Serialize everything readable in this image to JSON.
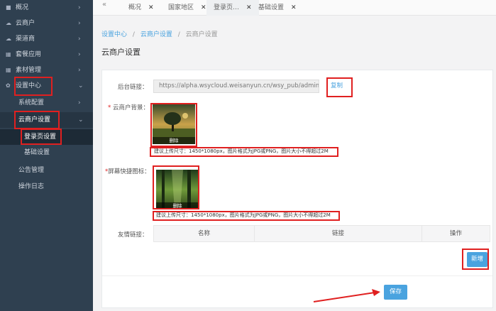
{
  "sidebar": {
    "items": [
      {
        "icon": "user-icon",
        "label": "概况"
      },
      {
        "icon": "cloud-icon",
        "label": "云商户"
      },
      {
        "icon": "channel-icon",
        "label": "渠道商"
      },
      {
        "icon": "grid-icon",
        "label": "套餐应用"
      },
      {
        "icon": "grid-icon",
        "label": "素材管理"
      },
      {
        "icon": "gear-icon",
        "label": "设置中心"
      }
    ],
    "sub_items": {
      "system_config": "系统配置",
      "cloud_merchant_settings": "云商户设置",
      "login_page_settings": "登录页设置",
      "basic_settings": "基础设置",
      "announcement_management": "公告管理",
      "operation_log": "操作日志"
    }
  },
  "topbar": {
    "collapse_icon": "«",
    "tabs": [
      {
        "label": "概况",
        "close": "✕"
      },
      {
        "label": "国家地区",
        "close": "✕"
      },
      {
        "label": "登录页…",
        "close": "✕"
      },
      {
        "label": "基础设置",
        "close": "✕"
      }
    ]
  },
  "breadcrumb": {
    "item1": "设置中心",
    "item2": "云商户设置",
    "item3": "云商户设置",
    "separator": "/"
  },
  "page_title": "云商户设置",
  "form": {
    "backend_link_label": "后台链接：",
    "backend_link_value": "https://alpha.wsycloud.weisanyun.cn/wsy_pub/admin/index.p",
    "copy_label": "复制",
    "bg_label_req": "*",
    "bg_label": " 云商户背景：",
    "bg_delete": "删除",
    "bg_hint": "建议上传尺寸：1450*1080px，图片格式为JPG或PNG，图片大小不得超过2M",
    "icon_label_req": "*",
    "icon_label": "屏幕快捷图标：",
    "icon_delete": "删除",
    "icon_hint": "建议上传尺寸：1450*1080px，图片格式为JPG或PNG，图片大小不得超过2M",
    "friend_links_label": "友情链接：",
    "columns": [
      "名称",
      "链接",
      "操作"
    ],
    "add_button": "新增",
    "save_button": "保存"
  },
  "colors": {
    "sidebar_bg": "#2f4050",
    "accent": "#4aa3df",
    "highlight": "#e02020"
  }
}
